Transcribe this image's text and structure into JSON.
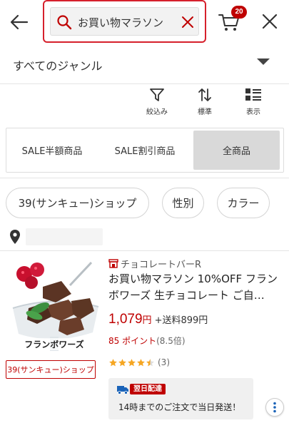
{
  "header": {
    "search_query": "お買い物マラソン",
    "cart_count": "20"
  },
  "genre": {
    "label": "すべてのジャンル"
  },
  "tools": [
    {
      "label": "絞込み",
      "icon": "filter-icon"
    },
    {
      "label": "標準",
      "icon": "sort-icon"
    },
    {
      "label": "表示",
      "icon": "view-icon"
    }
  ],
  "segments": [
    {
      "label": "SALE半額商品",
      "active": false
    },
    {
      "label": "SALE割引商品",
      "active": false
    },
    {
      "label": "全商品",
      "active": true
    }
  ],
  "chips": [
    {
      "label": "39(サンキュー)ショップ"
    },
    {
      "label": "性別"
    },
    {
      "label": "カラー"
    }
  ],
  "product": {
    "image_caption": "フランボワーズ",
    "shop_tag": "39(サンキュー)ショップ",
    "shop_name": "チョコレートバーR",
    "title": "お買い物マラソン 10%OFF フランボワーズ 生チョコレート ご自…",
    "price": "1,079",
    "yen": "円",
    "shipping": "+送料899円",
    "points": "85 ポイント",
    "points_rate": "(8.5倍)",
    "rating": 4.5,
    "review_count": "(3)",
    "delivery_badge": "翌日配達",
    "delivery_text": "14時までのご注文で当日発送！"
  },
  "colors": {
    "accent": "#bf0000",
    "star": "#f5a623"
  }
}
